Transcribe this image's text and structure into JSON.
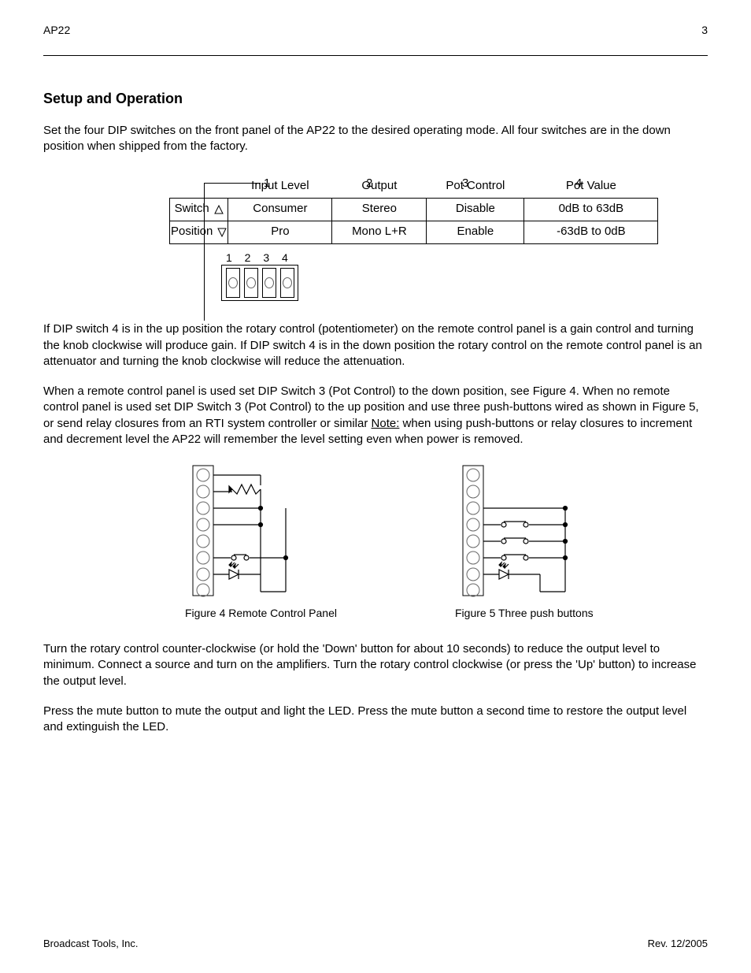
{
  "header": {
    "left": "AP22",
    "right": "3"
  },
  "section_title": "Setup and Operation",
  "intro": "Set the four DIP switches on the front panel of the AP22 to the desired operating mode. All four switches are in the down position when shipped from the factory.",
  "table": {
    "col_nums": [
      "1",
      "2",
      "3",
      "4"
    ],
    "col_headers": [
      "Input Level",
      "Output",
      "Pot Control",
      "Pot Value"
    ],
    "row_labels": {
      "group": "Switch",
      "sub": "Position"
    },
    "row_up": [
      "Consumer",
      "Stereo",
      "Disable",
      "0dB to 63dB"
    ],
    "row_down": [
      "Pro",
      "Mono L+R",
      "Enable",
      "-63dB to 0dB"
    ],
    "dip_nums": "1 2 3 4"
  },
  "p2": {
    "pre": "If DIP switch 4 is in the ",
    "up1": "up",
    "mid1": " position the rotary control (potentiometer) on the remote control panel is a gain control and turning the knob clockwise will produce gain. If DIP switch 4 is in the ",
    "up2": "down",
    "mid2": " position the rotary control on the remote control panel is an attenuator and turning the knob clockwise will reduce the attenuation."
  },
  "p3": {
    "t1": "When a remote control panel is used set DIP Switch 3 (Pot Control) to the down position, see Figure 4. When no remote control panel is used set DIP Switch 3 (Pot Control) to the up position and use three push-buttons wired as shown in Figure 5, or send relay closures from an RTI system controller or similar ",
    "note_label": "Note:",
    "note_text": " when using push-buttons or relay closures to increment and decrement level the AP22 will remember the level setting even when power is removed."
  },
  "figs": {
    "a": {
      "title": "Figure 4",
      "sub": "  Remote Control Panel"
    },
    "b": {
      "title": "Figure 5",
      "sub": "  Three push buttons"
    }
  },
  "p4": "Turn the rotary control counter-clockwise (or hold the 'Down' button for about 10 seconds) to reduce the output level to minimum. Connect a source and turn on the amplifiers. Turn the rotary control clockwise (or press the 'Up' button) to increase the output level.",
  "p5": "Press the mute button to mute the output and light the LED. Press the mute button a second time to restore the output level and extinguish the LED.",
  "footer": {
    "left": "Broadcast Tools, Inc.",
    "right": "Rev. 12/2005"
  }
}
